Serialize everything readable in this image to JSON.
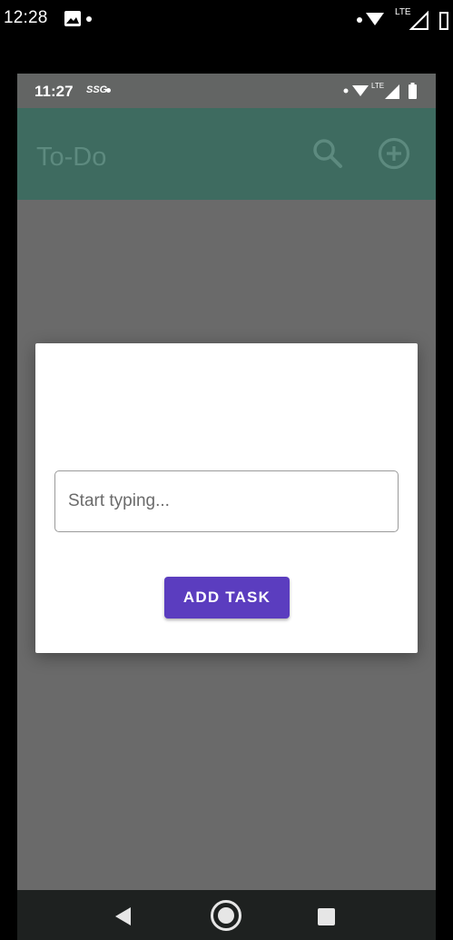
{
  "outer_status": {
    "time": "12:28",
    "network": "LTE"
  },
  "device_status": {
    "time": "11:27",
    "carrier_icon": "SSG",
    "network": "LTE"
  },
  "app_bar": {
    "title": "To-Do",
    "icons": [
      "search-icon",
      "add-circle-icon"
    ]
  },
  "dialog": {
    "input_placeholder": "Start typing...",
    "input_value": "",
    "button_label": "ADD TASK"
  },
  "nav_bar": {
    "icons": [
      "back-icon",
      "home-icon",
      "recents-icon"
    ]
  },
  "colors": {
    "app_bar": "#3e6b60",
    "scrim": "#6a6a6a",
    "button": "#5b3dbf",
    "dialog": "#ffffff"
  }
}
